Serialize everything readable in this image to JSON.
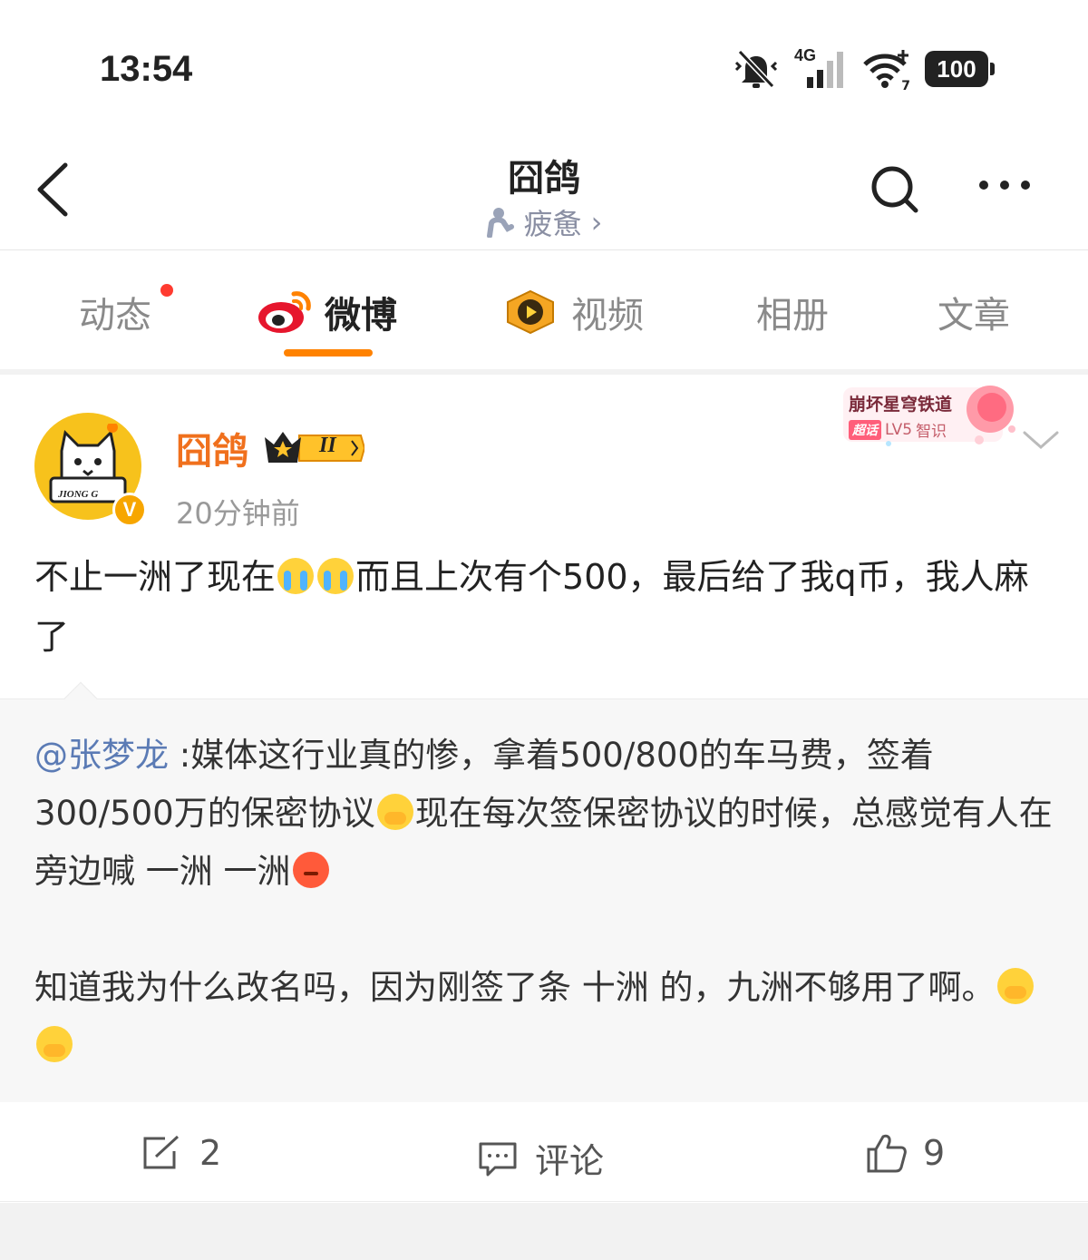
{
  "status_bar": {
    "time": "13:54",
    "network": "4G",
    "wifi_sub": "7",
    "battery": "100",
    "icons": [
      "mute-bell-icon",
      "signal-icon",
      "wifi-icon",
      "battery-icon"
    ]
  },
  "header": {
    "title": "囧鸽",
    "subtitle": "疲惫",
    "subtitle_chevron": "›",
    "icons": [
      "back-arrow-icon",
      "search-icon",
      "more-icon"
    ]
  },
  "tabs": [
    {
      "label": "动态",
      "has_dot": true
    },
    {
      "label": "微博",
      "active": true,
      "icon": "weibo-logo-icon"
    },
    {
      "label": "视频",
      "icon": "video-play-icon"
    },
    {
      "label": "相册"
    },
    {
      "label": "文章"
    }
  ],
  "post": {
    "username": "囧鸽",
    "avatar_text": "JIONG G",
    "verified_badge": "V",
    "member_level": "II",
    "time": "20分钟前",
    "badge": {
      "name": "崩坏星穹铁道",
      "tag": "超话",
      "level": "LV5",
      "level_label": "智识"
    },
    "text_parts": [
      "不止一洲了现在",
      "而且上次有个500，最后给了我q币，我人麻了"
    ]
  },
  "repost": {
    "mention": "@张梦龙",
    "line1_parts": [
      " :媒体这行业真的惨，拿着500/800的车马费，签着300/500万的保密协议",
      "现在每次签保密协议的时候，总感觉有人在旁边喊 一洲 一洲"
    ],
    "line2_parts": [
      "知道我为什么改名吗，因为刚签了条 十洲 的，九洲不够用了啊。"
    ]
  },
  "actions": {
    "repost_count": "2",
    "comment_label": "评论",
    "like_count": "9"
  },
  "colors": {
    "accent": "#ff8200",
    "username": "#f0701d",
    "mention": "#5b7bb5"
  }
}
